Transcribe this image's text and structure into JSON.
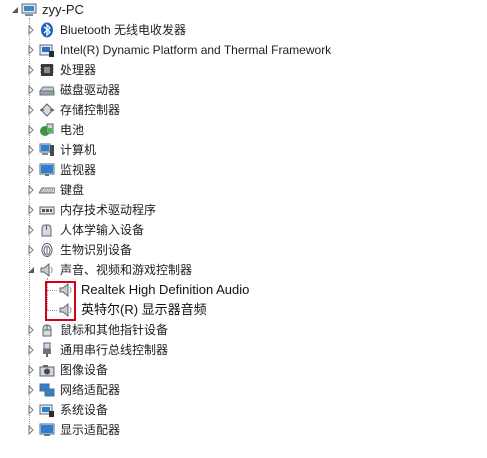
{
  "tree": {
    "root": {
      "label": "zyy-PC",
      "icon": "computer-icon"
    },
    "categories": [
      {
        "id": "bluetooth",
        "label": "Bluetooth 无线电收发器",
        "icon": "bluetooth-icon",
        "expanded": false
      },
      {
        "id": "intel-dptf",
        "label": "Intel(R) Dynamic Platform and Thermal Framework",
        "icon": "chip-icon",
        "expanded": false
      },
      {
        "id": "processors",
        "label": "处理器",
        "icon": "processor-icon",
        "expanded": false
      },
      {
        "id": "disk-drives",
        "label": "磁盘驱动器",
        "icon": "disk-drive-icon",
        "expanded": false
      },
      {
        "id": "storage-controllers",
        "label": "存储控制器",
        "icon": "storage-controller-icon",
        "expanded": false
      },
      {
        "id": "batteries",
        "label": "电池",
        "icon": "battery-icon",
        "expanded": false
      },
      {
        "id": "computer",
        "label": "计算机",
        "icon": "computer-icon",
        "expanded": false
      },
      {
        "id": "monitors",
        "label": "监视器",
        "icon": "monitor-icon",
        "expanded": false
      },
      {
        "id": "keyboards",
        "label": "键盘",
        "icon": "keyboard-icon",
        "expanded": false
      },
      {
        "id": "memory-tech",
        "label": "内存技术驱动程序",
        "icon": "memory-icon",
        "expanded": false
      },
      {
        "id": "hid",
        "label": "人体学输入设备",
        "icon": "hid-icon",
        "expanded": false
      },
      {
        "id": "biometric",
        "label": "生物识别设备",
        "icon": "fingerprint-icon",
        "expanded": false
      },
      {
        "id": "sound",
        "label": "声音、视频和游戏控制器",
        "icon": "speaker-icon",
        "expanded": true,
        "children": [
          {
            "id": "realtek",
            "label": "Realtek High Definition Audio",
            "icon": "speaker-icon"
          },
          {
            "id": "intel-display-audio",
            "label": "英特尔(R) 显示器音频",
            "icon": "speaker-icon"
          }
        ]
      },
      {
        "id": "mice",
        "label": "鼠标和其他指针设备",
        "icon": "mouse-icon",
        "expanded": false
      },
      {
        "id": "usb",
        "label": "通用串行总线控制器",
        "icon": "usb-icon",
        "expanded": false
      },
      {
        "id": "imaging",
        "label": "图像设备",
        "icon": "camera-icon",
        "expanded": false
      },
      {
        "id": "network",
        "label": "网络适配器",
        "icon": "network-icon",
        "expanded": false
      },
      {
        "id": "system",
        "label": "系统设备",
        "icon": "system-device-icon",
        "expanded": false
      },
      {
        "id": "display",
        "label": "显示适配器",
        "icon": "display-adapter-icon",
        "expanded": false
      }
    ]
  },
  "colors": {
    "highlight": "#d0021b",
    "arrow": "#7a7a7a"
  }
}
